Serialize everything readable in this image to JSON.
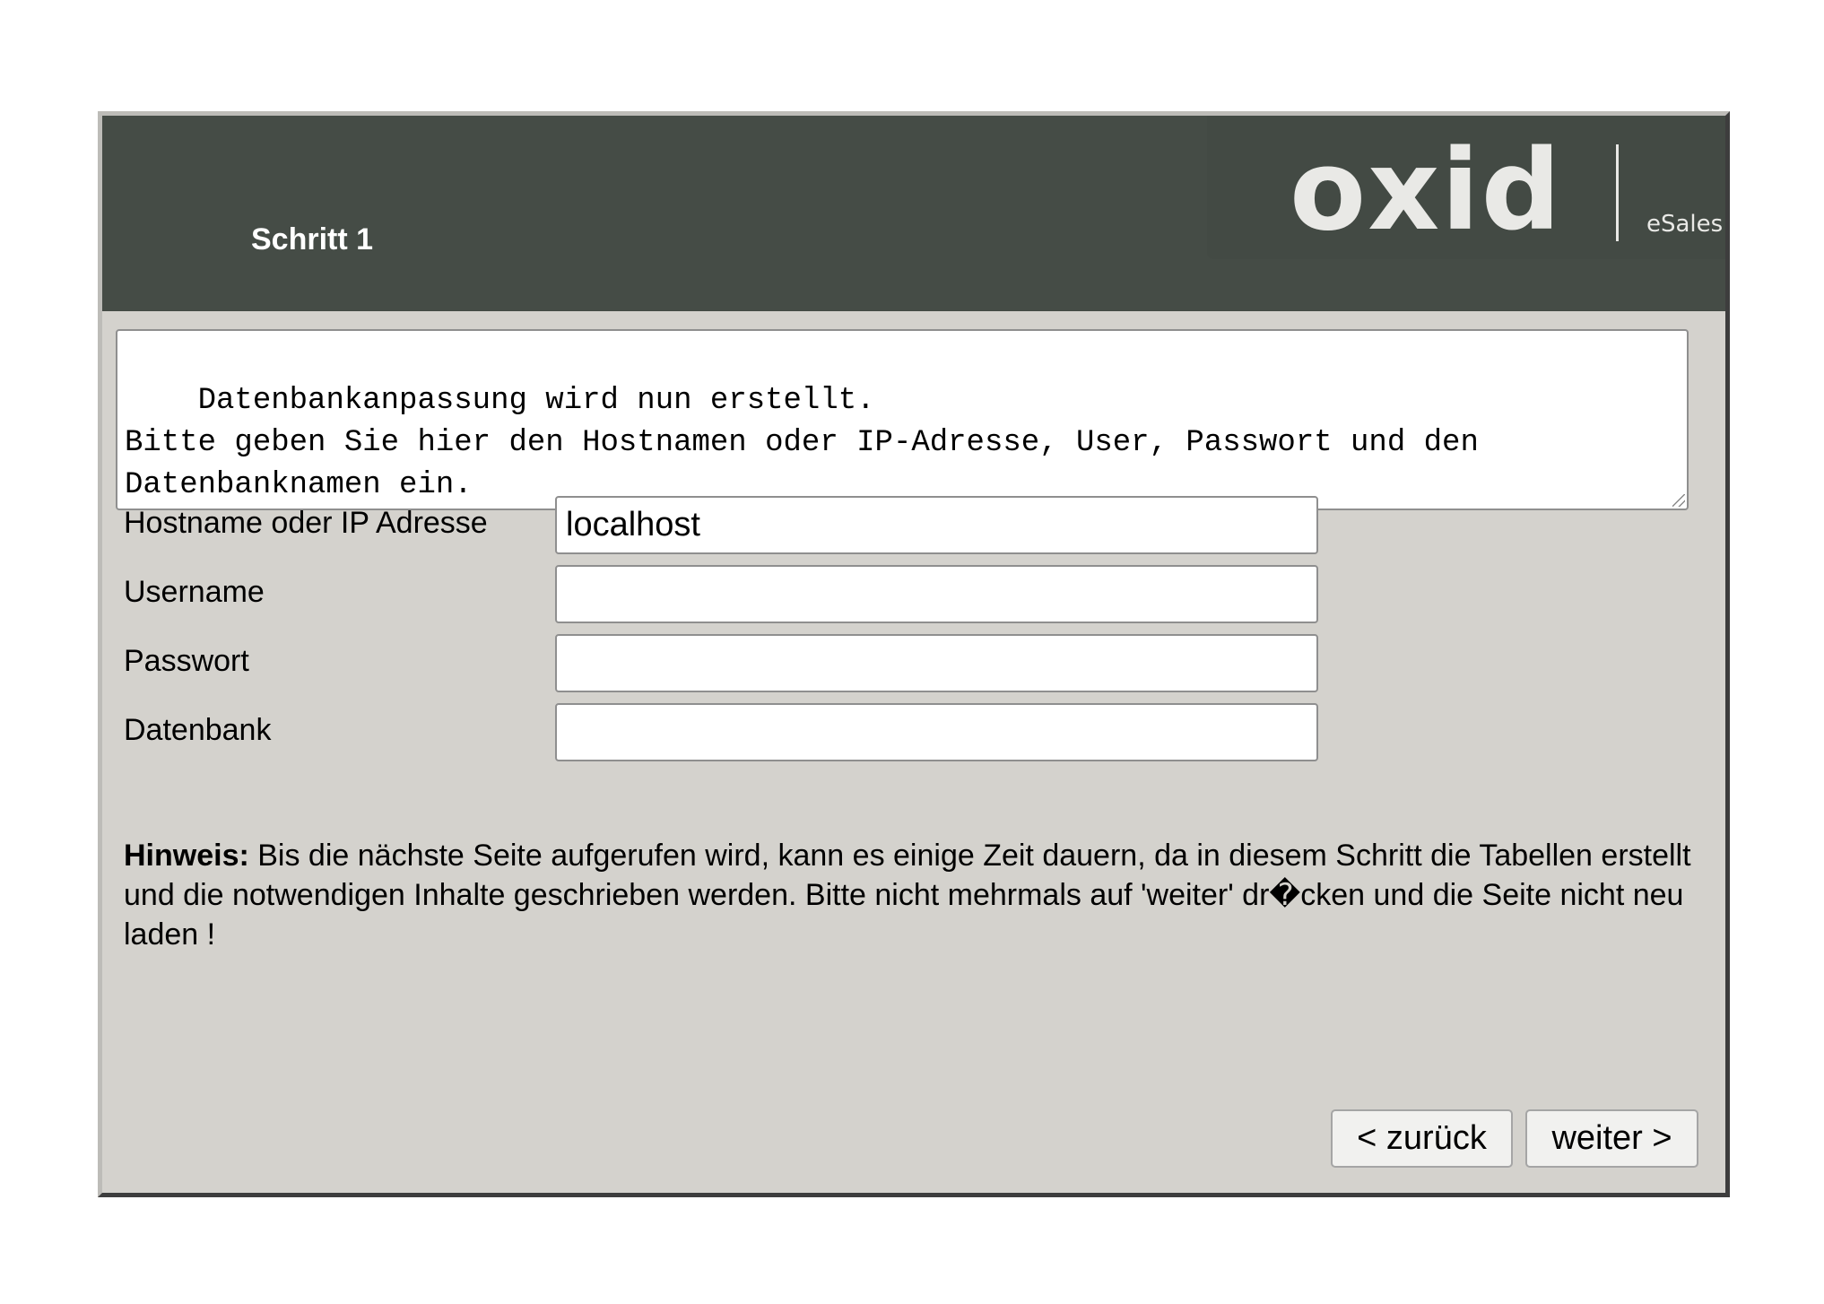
{
  "header": {
    "step_title": "Schritt 1",
    "logo_text": "oxid",
    "logo_subtext": "eSales"
  },
  "info_text": "Datenbankanpassung wird nun erstellt.\nBitte geben Sie hier den Hostnamen oder IP-Adresse, User, Passwort und den Datenbanknamen ein.",
  "form": {
    "host": {
      "label": "Hostname oder IP Adresse",
      "value": "localhost"
    },
    "user": {
      "label": "Username",
      "value": ""
    },
    "password": {
      "label": "Passwort",
      "value": ""
    },
    "database": {
      "label": "Datenbank",
      "value": ""
    }
  },
  "notice": {
    "label": "Hinweis:",
    "text": " Bis die nächste Seite aufgerufen wird, kann es einige Zeit dauern, da in diesem Schritt die Tabellen erstellt und die notwendigen Inhalte geschrieben werden. Bitte nicht mehrmals auf 'weiter' dr�cken und die Seite nicht neu laden !"
  },
  "buttons": {
    "back": "< zurück",
    "next": "weiter >"
  },
  "colors": {
    "header_bg": "#454c46",
    "panel_bg": "#d4d2cd",
    "logo_text": "#e9e9e6"
  },
  "icons": {
    "resize_grip": "textarea-resize-grip-icon"
  }
}
